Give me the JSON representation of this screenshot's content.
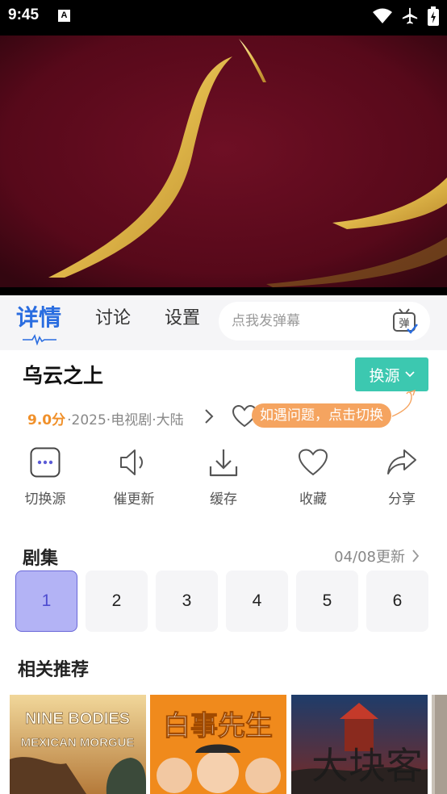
{
  "status_bar": {
    "time": "9:45",
    "a_icon_label": "A"
  },
  "tabs": [
    {
      "label": "详情",
      "active": true
    },
    {
      "label": "讨论",
      "active": false
    },
    {
      "label": "设置",
      "active": false
    }
  ],
  "danmu": {
    "placeholder": "点我发弹幕",
    "icon_label": "弹"
  },
  "show": {
    "title": "乌云之上",
    "score": "9.0分",
    "meta": "·2025·电视剧·大陆"
  },
  "switch_source": {
    "label": "换源"
  },
  "tip": {
    "text": "如遇问题，点击切换"
  },
  "actions": [
    {
      "label": "切换源",
      "icon": "more-dots-icon"
    },
    {
      "label": "催更新",
      "icon": "speaker-icon"
    },
    {
      "label": "缓存",
      "icon": "download-icon"
    },
    {
      "label": "收藏",
      "icon": "heart-icon"
    },
    {
      "label": "分享",
      "icon": "share-icon"
    }
  ],
  "episodes": {
    "title": "剧集",
    "update": "04/08更新",
    "items": [
      "1",
      "2",
      "3",
      "4",
      "5",
      "6"
    ],
    "active_index": 0
  },
  "recommendations": {
    "title": "相关推荐",
    "items": [
      {
        "poster_text": "NINE BODIES",
        "poster_subtext": "MEXICAN MORGUE"
      },
      {
        "poster_text": "白事先生"
      },
      {
        "poster_text": "大块客"
      }
    ]
  },
  "colors": {
    "accent_blue": "#2a6de0",
    "switch_button": "#3cc8b0",
    "score_orange": "#f0902a",
    "tip_orange": "#f5a460",
    "episode_active_bg": "#b3b3f5"
  }
}
